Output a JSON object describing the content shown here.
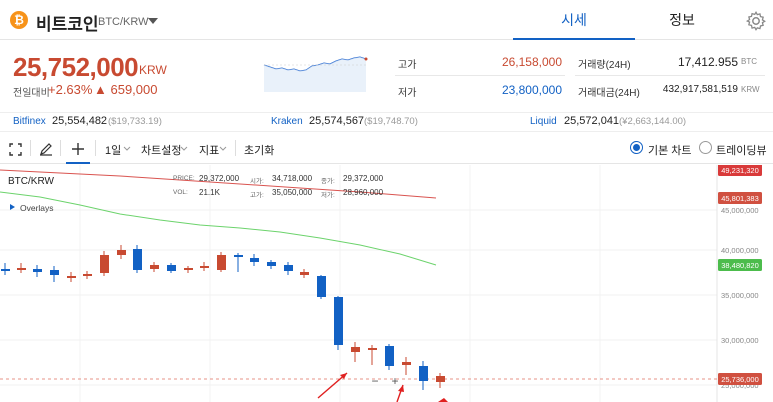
{
  "header": {
    "coin_symbol_glyph": "₿",
    "coin_name": "비트코인",
    "pair": "BTC/KRW",
    "tabs": [
      {
        "label": "시세"
      },
      {
        "label": "정보"
      }
    ]
  },
  "summary": {
    "price": "25,752,000",
    "price_unit": "KRW",
    "change_label": "전일대비",
    "change_pct": "+2.63%",
    "change_abs": "▲ 659,000",
    "high_label": "고가",
    "high_value": "26,158,000",
    "low_label": "저가",
    "low_value": "23,800,000",
    "volume_label": "거래량(24H)",
    "volume_value": "17,412.955",
    "volume_unit": "BTC",
    "amount_label": "거래대금(24H)",
    "amount_value": "432,917,581,519",
    "amount_unit": "KRW"
  },
  "exchanges": [
    {
      "name": "Bitfinex",
      "price": "25,554,482",
      "krw": "($19,733.19)"
    },
    {
      "name": "Kraken",
      "price": "25,574,567",
      "krw": "($19,748.70)"
    },
    {
      "name": "Liquid",
      "price": "25,572,041",
      "krw": "(¥2,663,144.00)"
    }
  ],
  "toolbar": {
    "interval": "1일",
    "chart_settings": "차트설정",
    "indicators": "지표",
    "reset": "초기화",
    "basic_chart": "기본 차트",
    "tradingview": "트레이딩뷰"
  },
  "chart": {
    "symbol": "BTC/KRW",
    "overlays": "Overlays",
    "price_label": "PRICE:",
    "price_value": "29,372,000",
    "open_label": "시가:",
    "open_value": "34,718,000",
    "close_label": "종가:",
    "close_value": "29,372,000",
    "vol_label": "VOL:",
    "vol_value": "21.1K",
    "high_label": "고가:",
    "high_value": "35,050,000",
    "low_label": "저가:",
    "low_value": "28,960,000",
    "axis_labels": [
      "45,000,000",
      "40,000,000",
      "35,000,000",
      "30,000,000",
      "25,000,000"
    ],
    "badges": [
      {
        "text": "49,231,320",
        "color": "#d93a3a"
      },
      {
        "text": "45,801,383",
        "color": "#d05040"
      },
      {
        "text": "38,480,820",
        "color": "#4cbc4c"
      },
      {
        "text": "25,736,000",
        "color": "#d05040"
      }
    ]
  },
  "colors": {
    "up": "#c84a31",
    "down": "#1261c4",
    "accent": "#1261c4"
  }
}
